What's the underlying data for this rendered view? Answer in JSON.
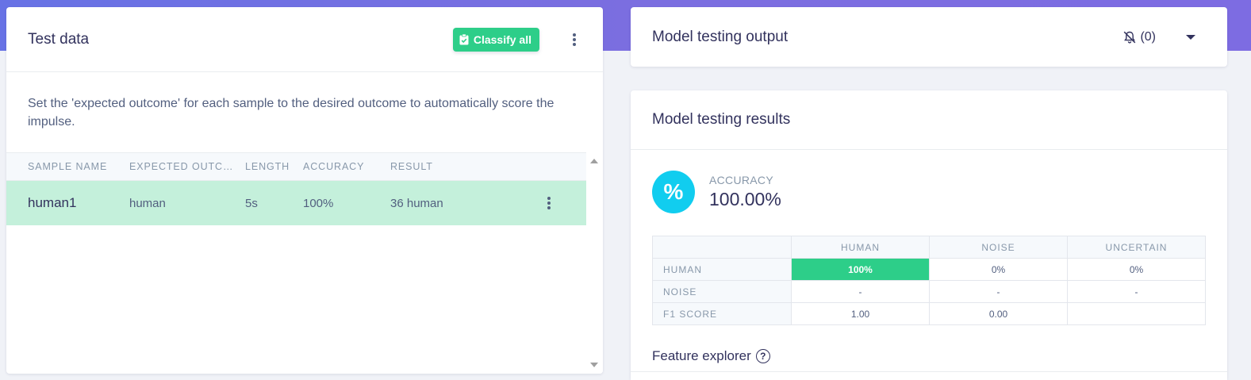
{
  "test_data": {
    "title": "Test data",
    "classify_all_label": "Classify all",
    "description": "Set the 'expected outcome' for each sample to the desired outcome to automatically score the impulse.",
    "columns": [
      "SAMPLE NAME",
      "EXPECTED OUTCO...",
      "LENGTH",
      "ACCURACY",
      "RESULT"
    ],
    "rows": [
      {
        "sample_name": "human1",
        "expected_outcome": "human",
        "length": "5s",
        "accuracy": "100%",
        "result": "36 human",
        "highlight_color": "#c4f0db"
      }
    ]
  },
  "output": {
    "title": "Model testing output",
    "notifications": "(0)"
  },
  "results": {
    "title": "Model testing results",
    "accuracy_label": "ACCURACY",
    "accuracy_value": "100.00%",
    "accuracy_icon_text": "%",
    "confusion_matrix": {
      "columns": [
        "HUMAN",
        "NOISE",
        "UNCERTAIN"
      ],
      "rows": [
        {
          "label": "HUMAN",
          "values": [
            "100%",
            "0%",
            "0%"
          ]
        },
        {
          "label": "NOISE",
          "values": [
            "-",
            "-",
            "-"
          ]
        },
        {
          "label": "F1 SCORE",
          "values": [
            "1.00",
            "0.00",
            ""
          ]
        }
      ]
    },
    "feature_explorer_label": "Feature explorer",
    "help_icon_text": "?"
  },
  "colors": {
    "accent_green": "#2dce89",
    "accent_cyan": "#11cdef",
    "header_gradient_start": "#6772e5",
    "header_gradient_end": "#7d6ce2"
  },
  "icons": {
    "classify_button": "clipboard-check-icon",
    "notifications": "bell-slash-icon",
    "menu": "kebab-menu-icon",
    "dropdown": "caret-down-icon"
  }
}
